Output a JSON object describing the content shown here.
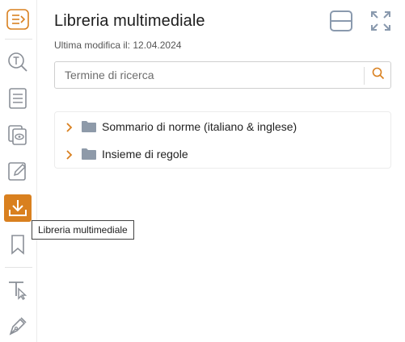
{
  "panel": {
    "title": "Libreria multimediale",
    "modified_label": "Ultima modifica il:",
    "modified_date": "12.04.2024"
  },
  "search": {
    "placeholder": "Termine di ricerca"
  },
  "tree": {
    "items": [
      {
        "label": "Sommario di norme (italiano & inglese)"
      },
      {
        "label": "Insieme di regole"
      }
    ]
  },
  "tooltip": {
    "text": "Libreria multimediale"
  },
  "rail": {
    "items": [
      {
        "icon": "sidebar-toggle-icon"
      },
      {
        "icon": "text-search-icon"
      },
      {
        "icon": "list-icon"
      },
      {
        "icon": "view-copies-icon"
      },
      {
        "icon": "edit-note-icon"
      },
      {
        "icon": "download-icon"
      },
      {
        "icon": "bookmark-icon"
      },
      {
        "icon": "text-select-icon"
      },
      {
        "icon": "pen-icon"
      }
    ]
  },
  "colors": {
    "accent": "#d9801f",
    "icon_gray": "#8a8f97",
    "header_icon": "#8a9aae"
  }
}
